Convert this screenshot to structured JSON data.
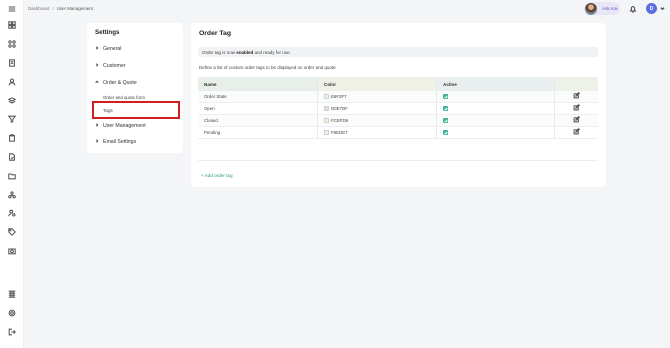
{
  "rail": {
    "icons": [
      "menu-icon",
      "dashboard-icon",
      "grid-icon",
      "document-icon",
      "user-icon",
      "layers-icon",
      "funnel-icon",
      "clipboard-icon",
      "file-icon",
      "folder-icon",
      "network-icon",
      "user-settings-icon",
      "tag-icon",
      "camera-icon",
      "apps-icon",
      "settings-icon",
      "logout-icon"
    ]
  },
  "breadcrumb": {
    "home": "Dashboard",
    "separator": "/",
    "current": "User Management"
  },
  "user": {
    "name": "Ask Kai",
    "initial": "D"
  },
  "settings": {
    "title": "Settings",
    "items": [
      {
        "label": "General"
      },
      {
        "label": "Customer"
      },
      {
        "label": "Order & Quote"
      },
      {
        "label": "User Management"
      },
      {
        "label": "Email Settings"
      }
    ],
    "sub_items": [
      {
        "label": "Order and quote form"
      },
      {
        "label": "Tags"
      }
    ]
  },
  "main": {
    "title": "Order Tag",
    "info_prefix": "Order tag is now ",
    "info_bold": "enabled",
    "info_suffix": " and ready for use.",
    "description": "Define a list of custom order tags to be displayed on order and quote",
    "columns": {
      "name": "Name",
      "color": "Color",
      "active": "Active",
      "actions": ""
    },
    "rows": [
      {
        "name": "Order State",
        "color": "E6F3F7",
        "swatch": "#E6F3F7",
        "active": true
      },
      {
        "name": "Open",
        "color": "D0E7DF",
        "swatch": "#D0E7DF",
        "active": true
      },
      {
        "name": "Closed",
        "color": "FCEFD6",
        "swatch": "#FCEFD6",
        "active": true
      },
      {
        "name": "Pending",
        "color": "F8EDE7",
        "swatch": "#F8EDE7",
        "active": true
      }
    ],
    "add_label": "+ Add order tag"
  },
  "colors": {
    "accent": "#2f9e6b",
    "highlight": "#d11f1f",
    "check": "#44b39a",
    "user": "#6b57c8"
  }
}
